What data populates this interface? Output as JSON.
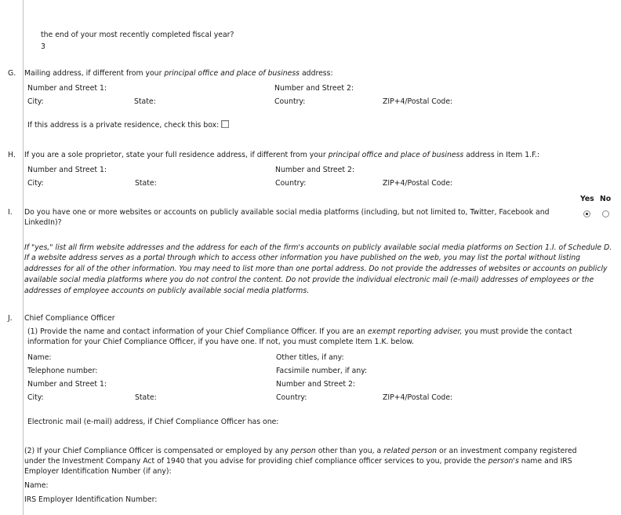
{
  "top": {
    "line1": "the end of your most recently completed fiscal year?",
    "value": "3"
  },
  "itemG": {
    "letter": "G.",
    "q_pre": "Mailing address, if different from your ",
    "q_ital": "principal office and place of business",
    "q_post": " address:",
    "street1": "Number and Street 1:",
    "street2": "Number and Street 2:",
    "city": "City:",
    "state": "State:",
    "country": "Country:",
    "zip": "ZIP+4/Postal Code:",
    "private": "If this address is a private residence, check this box:"
  },
  "itemH": {
    "letter": "H.",
    "q_pre": "If you are a sole proprietor, state your full residence address, if different from your ",
    "q_ital": "principal office and place of business",
    "q_post": " address in Item 1.F.:",
    "street1": "Number and Street 1:",
    "street2": "Number and Street 2:",
    "city": "City:",
    "state": "State:",
    "country": "Country:",
    "zip": "ZIP+4/Postal Code:"
  },
  "itemI": {
    "letter": "I.",
    "yes": "Yes",
    "no": "No",
    "selected": "Yes",
    "q_line1": "Do you have one or more websites or accounts on publicly available social media platforms (including, but not limited to, Twitter, Facebook and",
    "q_line2": "LinkedIn)?",
    "note": [
      "If \"yes,\" list all firm website addresses and the address for each of the firm's accounts on publicly available social media platforms on Section 1.I. of Schedule D.",
      "If a website address serves as a portal through which to access other information you have published on the web, you may list the portal without listing",
      "addresses for all of the other information. You may need to list more than one portal address. Do not provide the addresses of websites or accounts on publicly",
      "available social media platforms where you do not control the content. Do not provide the individual electronic mail (e-mail) addresses of employees or the",
      "addresses of employee accounts on publicly available social media platforms."
    ]
  },
  "itemJ": {
    "letter": "J.",
    "title": "Chief Compliance Officer",
    "p1_pre": "(1) Provide the name and contact information of your Chief Compliance Officer. If you are an ",
    "p1_ital": "exempt reporting adviser,",
    "p1_post": " you must provide the contact",
    "p1_line2": "information for your Chief Compliance Officer, if you have one. If not, you must complete Item 1.K. below.",
    "name": "Name:",
    "other_titles": "Other titles, if any:",
    "telephone": "Telephone number:",
    "fax": "Facsimile number, if any:",
    "street1": "Number and Street 1:",
    "street2": "Number and Street 2:",
    "city": "City:",
    "state": "State:",
    "country": "Country:",
    "zip": "ZIP+4/Postal Code:",
    "email": "Electronic mail (e-mail) address, if Chief Compliance Officer has one:",
    "p2_a": "(2) If your Chief Compliance Officer is compensated or employed by any ",
    "p2_b": "person",
    "p2_c": " other than you, a ",
    "p2_d": "related person",
    "p2_e": " or an investment company registered",
    "p2_line2_a": "under the Investment Company Act of 1940 that you advise for providing chief compliance officer services to you, provide the ",
    "p2_line2_b": "person's",
    "p2_line2_c": " name and IRS",
    "p2_line3": "Employer Identification Number (if any):",
    "name2": "Name:",
    "irs": "IRS Employer Identification Number:"
  }
}
